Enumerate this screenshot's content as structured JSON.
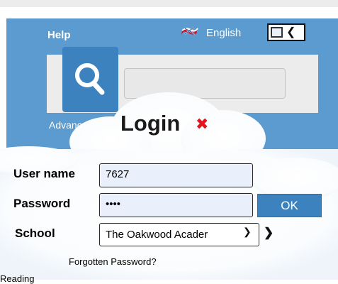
{
  "header": {
    "help": "Help",
    "language": "English",
    "advanced": "Advance"
  },
  "login": {
    "title": "Login",
    "close_icon": "✖",
    "username_label": "User name",
    "username_value": "7627",
    "password_label": "Password",
    "password_value": "••••",
    "school_label": "School",
    "school_value": "The Oakwood Acader",
    "ok_label": "OK",
    "forgot": "Forgotten Password?"
  },
  "footer": {
    "partial_text": "Reading"
  },
  "colors": {
    "header_bg": "#5b9bcf",
    "button_blue": "#3b82bf",
    "close_red": "#e0161c"
  }
}
